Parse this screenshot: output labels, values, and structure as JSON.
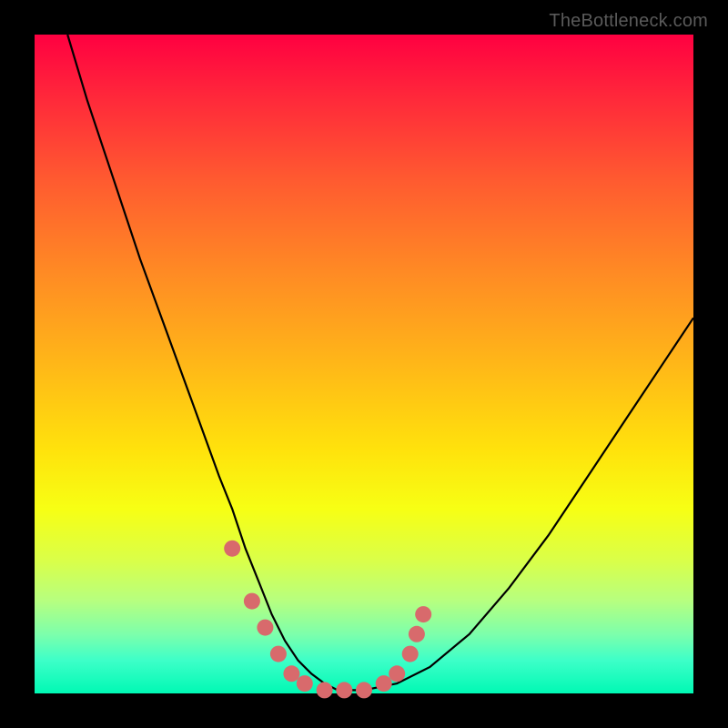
{
  "watermark": "TheBottleneck.com",
  "chart_data": {
    "type": "line",
    "title": "",
    "xlabel": "",
    "ylabel": "",
    "xlim": [
      0,
      100
    ],
    "ylim": [
      0,
      100
    ],
    "grid": false,
    "background_gradient": {
      "direction": "vertical",
      "stops": [
        {
          "pos": 0,
          "color": "#ff0041"
        },
        {
          "pos": 22,
          "color": "#ff5a30"
        },
        {
          "pos": 50,
          "color": "#ffb718"
        },
        {
          "pos": 72,
          "color": "#f7ff14"
        },
        {
          "pos": 91,
          "color": "#7dffab"
        },
        {
          "pos": 100,
          "color": "#00f9b4"
        }
      ]
    },
    "series": [
      {
        "name": "bottleneck-curve",
        "color": "#000000",
        "x": [
          5,
          8,
          12,
          16,
          20,
          24,
          28,
          30,
          32,
          34,
          36,
          38,
          40,
          42,
          44,
          46,
          50,
          55,
          60,
          66,
          72,
          78,
          84,
          90,
          96,
          100
        ],
        "y": [
          100,
          90,
          78,
          66,
          55,
          44,
          33,
          28,
          22,
          17,
          12,
          8,
          5,
          3,
          1.5,
          0.5,
          0.5,
          1.5,
          4,
          9,
          16,
          24,
          33,
          42,
          51,
          57
        ]
      }
    ],
    "markers": {
      "name": "highlight-points",
      "color": "#d86a6c",
      "radius_px": 9,
      "points": [
        {
          "x": 30,
          "y": 22
        },
        {
          "x": 33,
          "y": 14
        },
        {
          "x": 35,
          "y": 10
        },
        {
          "x": 37,
          "y": 6
        },
        {
          "x": 39,
          "y": 3
        },
        {
          "x": 41,
          "y": 1.5
        },
        {
          "x": 44,
          "y": 0.5
        },
        {
          "x": 47,
          "y": 0.5
        },
        {
          "x": 50,
          "y": 0.5
        },
        {
          "x": 53,
          "y": 1.5
        },
        {
          "x": 55,
          "y": 3
        },
        {
          "x": 57,
          "y": 6
        },
        {
          "x": 58,
          "y": 9
        },
        {
          "x": 59,
          "y": 12
        }
      ]
    }
  }
}
